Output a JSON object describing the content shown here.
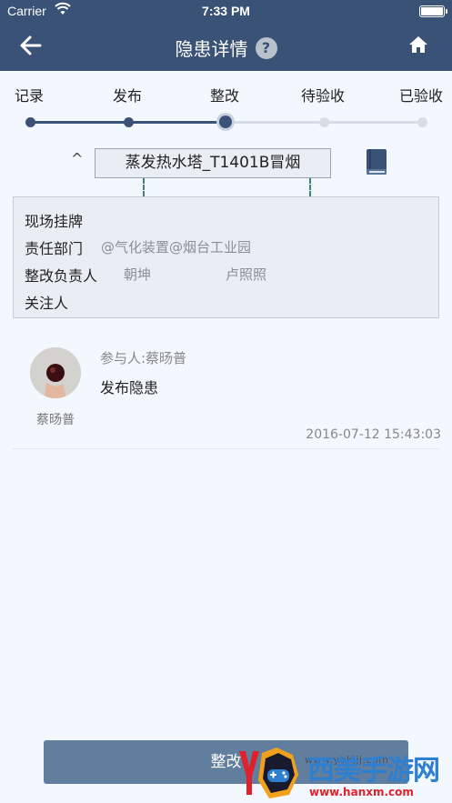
{
  "status_bar": {
    "carrier": "Carrier",
    "time": "7:33 PM"
  },
  "nav": {
    "title": "隐患详情",
    "help_label": "?"
  },
  "steps": [
    {
      "label": "记录",
      "state": "done"
    },
    {
      "label": "发布",
      "state": "done"
    },
    {
      "label": "整改",
      "state": "current"
    },
    {
      "label": "待验收",
      "state": "pending"
    },
    {
      "label": "已验收",
      "state": "pending"
    }
  ],
  "caret": "^",
  "tower_name": "蒸发热水塔_T1401B冒烟",
  "info": {
    "label_onsite": "现场挂牌",
    "label_department": "责任部门",
    "department_value": "@气化装置@烟台工业园",
    "label_rectifier": "整改负责人",
    "rectifier_1": "朝坤",
    "rectifier_2": "卢照照",
    "label_followers": "关注人"
  },
  "record": {
    "participant": "参与人:蔡旸普",
    "action": "发布隐患",
    "avatar_name": "蔡旸普",
    "time": "2016-07-12 15:43:03"
  },
  "bottom_button": "整改",
  "watermark": {
    "logo_text": "西美手游网",
    "url": "www.hanxm.com",
    "faint_url": "www.ybkjjj.com"
  },
  "colors": {
    "header": "#3a5276",
    "accent": "#627e9f",
    "background": "#f2f8fd"
  }
}
